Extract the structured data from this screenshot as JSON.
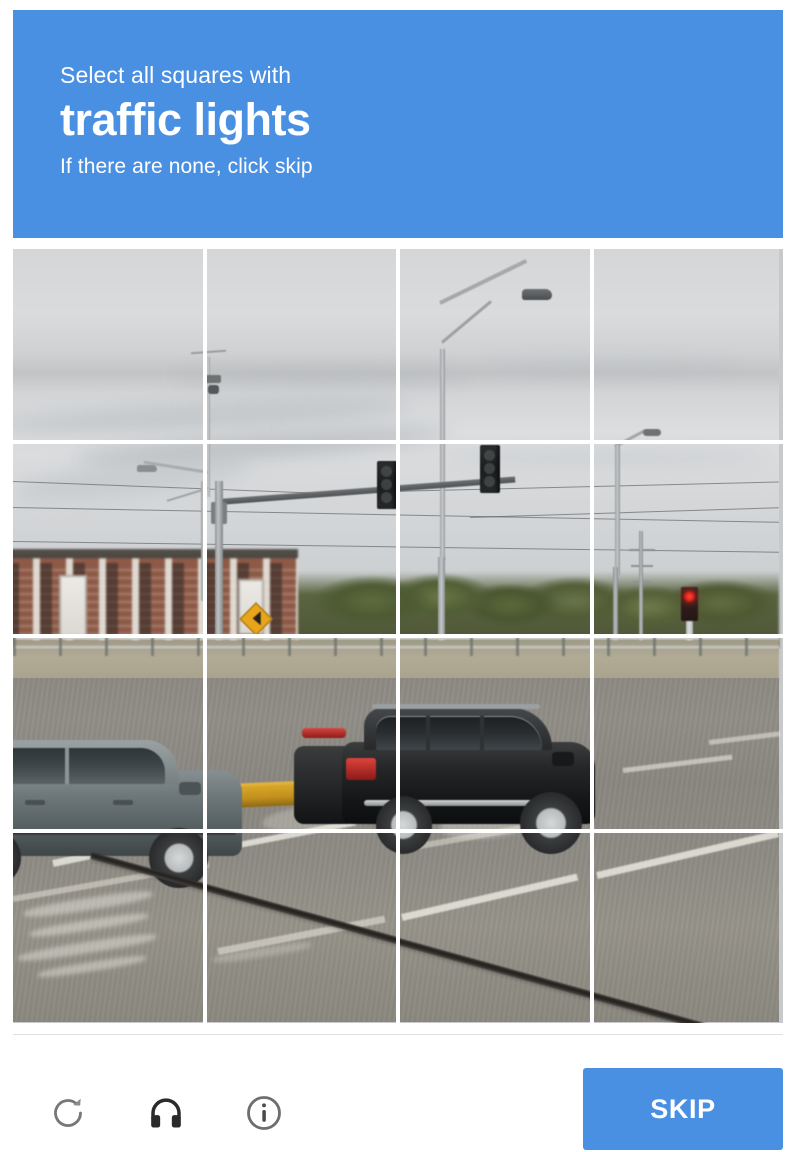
{
  "widget": {
    "name": "recaptcha-image-challenge",
    "accent_color": "#4a90e2",
    "background_color": "#ffffff"
  },
  "header": {
    "lead": "Select all squares with",
    "target": "traffic lights",
    "note": "If there are none, click skip"
  },
  "grid": {
    "rows": 4,
    "columns": 4,
    "selected_count": 0,
    "tiles": [
      {
        "id": "tile-r1c1",
        "row": 1,
        "col": 1,
        "content": "overcast gray sky with cloud bands",
        "selected": false
      },
      {
        "id": "tile-r1c2",
        "row": 1,
        "col": 2,
        "content": "sky with camera mast pole",
        "selected": false
      },
      {
        "id": "tile-r1c3",
        "row": 1,
        "col": 3,
        "content": "sky with street light arm and lamp head",
        "selected": false
      },
      {
        "id": "tile-r1c4",
        "row": 1,
        "col": 4,
        "content": "plain overcast sky",
        "selected": false
      },
      {
        "id": "tile-r2c1",
        "row": 2,
        "col": 1,
        "content": "street light and brick apartment building",
        "selected": false
      },
      {
        "id": "tile-r2c2",
        "row": 2,
        "col": 2,
        "content": "signal mast arm, traffic light, yellow diamond sign",
        "selected": false
      },
      {
        "id": "tile-r2c3",
        "row": 2,
        "col": 3,
        "content": "traffic light on mast arm above trees",
        "selected": false
      },
      {
        "id": "tile-r2c4",
        "row": 2,
        "col": 4,
        "content": "utility poles and red traffic light",
        "selected": false
      },
      {
        "id": "tile-r3c1",
        "row": 3,
        "col": 1,
        "content": "silver SUV beside guardrail",
        "selected": false
      },
      {
        "id": "tile-r3c2",
        "row": 3,
        "col": 2,
        "content": "yellow median curb and roadway",
        "selected": false
      },
      {
        "id": "tile-r3c3",
        "row": 3,
        "col": 3,
        "content": "black SUV on roadway",
        "selected": false
      },
      {
        "id": "tile-r3c4",
        "row": 3,
        "col": 4,
        "content": "empty roadway with lane markings",
        "selected": false
      },
      {
        "id": "tile-r4c1",
        "row": 4,
        "col": 1,
        "content": "pavement with faded paint markings",
        "selected": false
      },
      {
        "id": "tile-r4c2",
        "row": 4,
        "col": 2,
        "content": "pavement with expansion joint crack",
        "selected": false
      },
      {
        "id": "tile-r4c3",
        "row": 4,
        "col": 3,
        "content": "pavement with lane line and crack",
        "selected": false
      },
      {
        "id": "tile-r4c4",
        "row": 4,
        "col": 4,
        "content": "pavement with lane line",
        "selected": false
      }
    ]
  },
  "footer": {
    "reload_icon": "refresh-icon",
    "audio_icon": "headphones-icon",
    "info_icon": "info-icon",
    "skip_label": "SKIP"
  }
}
